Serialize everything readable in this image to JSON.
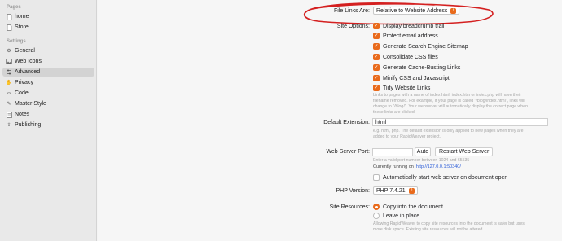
{
  "sidebar": {
    "pages_header": "Pages",
    "pages": [
      {
        "label": "home",
        "icon": "page-icon"
      },
      {
        "label": "Store",
        "icon": "page-icon"
      }
    ],
    "settings_header": "Settings",
    "settings": [
      {
        "label": "General",
        "icon": "gear-icon"
      },
      {
        "label": "Web Icons",
        "icon": "image-icon"
      },
      {
        "label": "Advanced",
        "icon": "sliders-icon",
        "selected": true
      },
      {
        "label": "Privacy",
        "icon": "hand-icon"
      },
      {
        "label": "Code",
        "icon": "code-icon"
      },
      {
        "label": "Master Style",
        "icon": "paintbrush-icon"
      },
      {
        "label": "Notes",
        "icon": "notes-icon"
      },
      {
        "label": "Publishing",
        "icon": "upload-icon"
      }
    ]
  },
  "file_links": {
    "label": "File Links Are:",
    "value": "Relative to Website Address"
  },
  "site_options": {
    "label": "Site Options:",
    "items": [
      {
        "label": "Display breadcrumb trail",
        "checked": true
      },
      {
        "label": "Protect email address",
        "checked": true
      },
      {
        "label": "Generate Search Engine Sitemap",
        "checked": true
      },
      {
        "label": "Consolidate CSS files",
        "checked": true
      },
      {
        "label": "Generate Cache-Busting Links",
        "checked": true
      },
      {
        "label": "Minify CSS and Javascript",
        "checked": true
      },
      {
        "label": "Tidy Website Links",
        "checked": true
      }
    ],
    "help": [
      "Links to pages with a name of index.html, index.htm or index.php will have their",
      "filename removed. For example, if your page is called \"/blog/index.html\", links will",
      "change to \"/blog/\". Your webserver will automatically display the correct page when",
      "these links are clicked."
    ]
  },
  "default_extension": {
    "label": "Default Extension:",
    "value": "html",
    "help": [
      "e.g. html, php. The default extension is only applied to new pages when they are",
      "added to your RapidWeaver project."
    ]
  },
  "web_server": {
    "label": "Web Server Port:",
    "value": "",
    "auto_label": "Auto",
    "restart_label": "Restart Web Server",
    "help": "Enter a valid port number between 1024 and 65535",
    "running_prefix": "Currently running on",
    "running_url": "http://127.0.0.1:50340/",
    "autostart_label": "Automatically start web server on document open",
    "autostart_checked": false
  },
  "php_version": {
    "label": "PHP Version:",
    "value": "PHP 7.4.21"
  },
  "site_resources": {
    "label": "Site Resources:",
    "options": [
      {
        "label": "Copy into the document",
        "selected": true
      },
      {
        "label": "Leave in place",
        "selected": false
      }
    ],
    "help": [
      "Allowing RapidWeaver to copy site resources into the document is safer but uses",
      "more disk space. Existing site resources will not be altered."
    ]
  },
  "colors": {
    "accent": "#e96a1b",
    "annotation": "#d42020",
    "link": "#2a5bd7"
  }
}
